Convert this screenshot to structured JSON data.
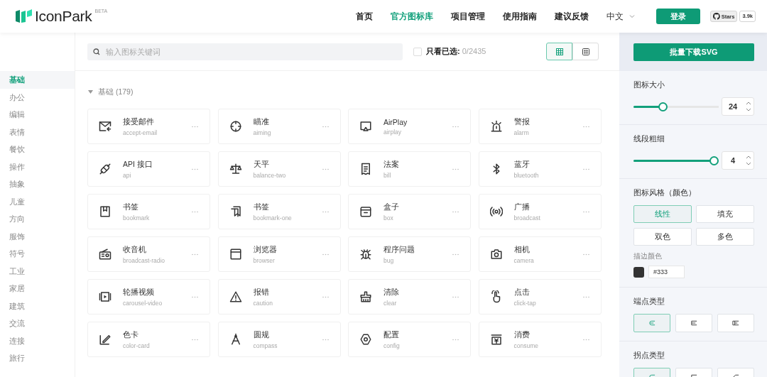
{
  "header": {
    "logo": "IconPark",
    "badge": "BETA",
    "nav": [
      {
        "label": "首页",
        "selected": false
      },
      {
        "label": "官方图标库",
        "selected": true
      },
      {
        "label": "项目管理",
        "selected": false
      },
      {
        "label": "使用指南",
        "selected": false
      },
      {
        "label": "建议反馈",
        "selected": false
      }
    ],
    "language": "中文",
    "login": "登录",
    "github": {
      "label": "Stars",
      "count": "3.9k"
    }
  },
  "sidebar": {
    "items": [
      {
        "label": "基础",
        "selected": true
      },
      {
        "label": "办公",
        "selected": false
      },
      {
        "label": "编辑",
        "selected": false
      },
      {
        "label": "表情",
        "selected": false
      },
      {
        "label": "餐饮",
        "selected": false
      },
      {
        "label": "操作",
        "selected": false
      },
      {
        "label": "抽象",
        "selected": false
      },
      {
        "label": "儿童",
        "selected": false
      },
      {
        "label": "方向",
        "selected": false
      },
      {
        "label": "服饰",
        "selected": false
      },
      {
        "label": "符号",
        "selected": false
      },
      {
        "label": "工业",
        "selected": false
      },
      {
        "label": "家居",
        "selected": false
      },
      {
        "label": "建筑",
        "selected": false
      },
      {
        "label": "交流",
        "selected": false
      },
      {
        "label": "连接",
        "selected": false
      },
      {
        "label": "旅行",
        "selected": false
      }
    ]
  },
  "toolbar": {
    "search": {
      "placeholder": "输入图标关键词"
    },
    "selected_only": {
      "label": "**只看已选:** 0/2435",
      "checked": false
    },
    "views": [
      {
        "kind": "list",
        "selected": true
      },
      {
        "kind": "grid",
        "selected": false
      }
    ]
  },
  "section": {
    "title": "基础 (179)",
    "expanded": true
  },
  "icons": [
    {
      "title": "接受邮件",
      "name": "accept-email"
    },
    {
      "title": "瞄准",
      "name": "aiming"
    },
    {
      "title": "AirPlay",
      "name": "airplay"
    },
    {
      "title": "警报",
      "name": "alarm"
    },
    {
      "title": "API 接口",
      "name": "api"
    },
    {
      "title": "天平",
      "name": "balance-two"
    },
    {
      "title": "法案",
      "name": "bill"
    },
    {
      "title": "蓝牙",
      "name": "bluetooth"
    },
    {
      "title": "书签",
      "name": "bookmark"
    },
    {
      "title": "书签",
      "name": "bookmark-one"
    },
    {
      "title": "盒子",
      "name": "box"
    },
    {
      "title": "广播",
      "name": "broadcast"
    },
    {
      "title": "收音机",
      "name": "broadcast-radio"
    },
    {
      "title": "浏览器",
      "name": "browser"
    },
    {
      "title": "程序问题",
      "name": "bug"
    },
    {
      "title": "相机",
      "name": "camera"
    },
    {
      "title": "轮播视频",
      "name": "carousel-video"
    },
    {
      "title": "报错",
      "name": "caution"
    },
    {
      "title": "清除",
      "name": "clear"
    },
    {
      "title": "点击",
      "name": "click-tap"
    },
    {
      "title": "色卡",
      "name": "color-card"
    },
    {
      "title": "圆规",
      "name": "compass"
    },
    {
      "title": "配置",
      "name": "config"
    },
    {
      "title": "消费",
      "name": "consume"
    }
  ],
  "panel": {
    "download": "批量下载SVG",
    "size": {
      "label": "图标大小",
      "level": 0.33,
      "value": "24"
    },
    "stroke": {
      "label": "线段粗细",
      "level": 1,
      "value": "4"
    },
    "style": {
      "label": "图标风格（颜色）",
      "options": [
        {
          "label": "线性",
          "selected": true
        },
        {
          "label": "填充",
          "selected": false
        },
        {
          "label": "双色",
          "selected": false
        },
        {
          "label": "多色",
          "selected": false
        }
      ]
    },
    "stroke_color": {
      "label": "描边颜色",
      "color": "#333333",
      "value": "#333"
    },
    "cap": {
      "label": "端点类型",
      "options": [
        {
          "kind": "round",
          "selected": true
        },
        {
          "kind": "butt",
          "selected": false
        },
        {
          "kind": "square",
          "selected": false
        }
      ]
    },
    "join": {
      "label": "拐点类型",
      "options": [
        {
          "kind": "round",
          "selected": true
        },
        {
          "kind": "miter",
          "selected": false
        },
        {
          "kind": "bevel",
          "selected": false
        }
      ]
    }
  }
}
